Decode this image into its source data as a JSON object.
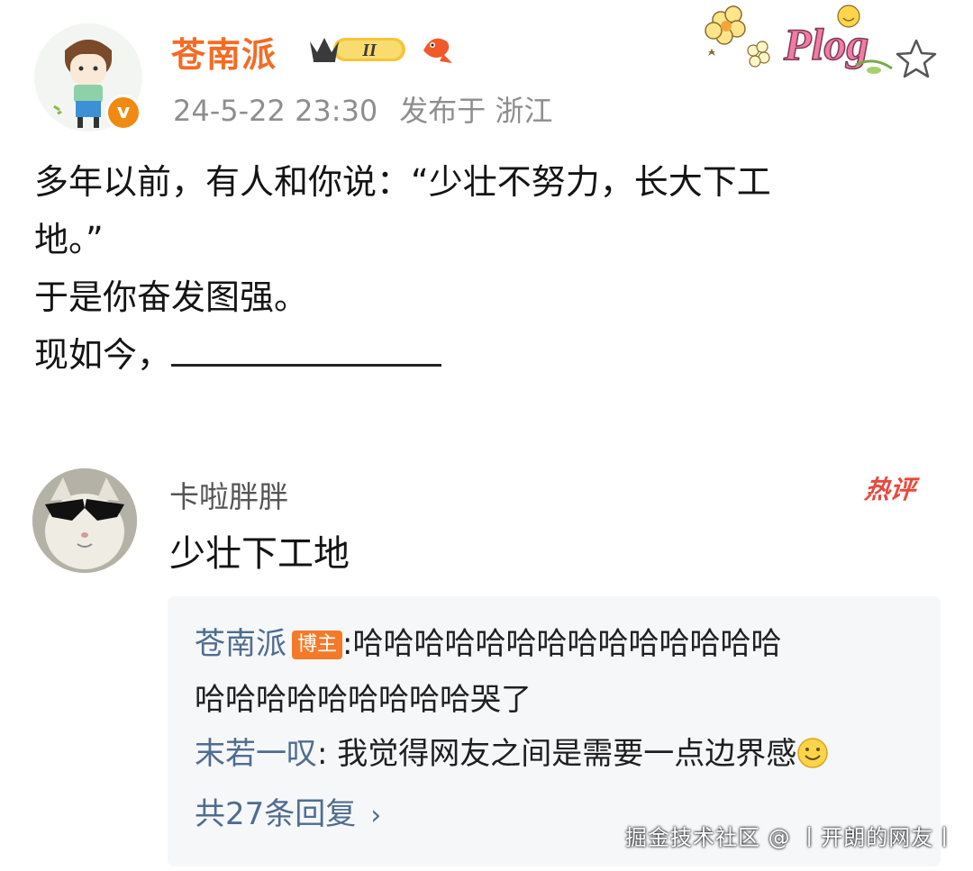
{
  "post": {
    "author": "苍南派",
    "level_badge": "II",
    "timestamp": "24-5-22 23:30",
    "location": "发布于 浙江",
    "decoration_text": "Plog",
    "lines": [
      "多年以前，有人和你说：“少壮不努力，长大下工",
      "地。”",
      "于是你奋发图强。",
      "现如今，"
    ]
  },
  "hot_comment": {
    "user": "卡啦胖胖",
    "badge": "热评",
    "text": "少壮下工地",
    "replies": [
      {
        "author": "苍南派",
        "tag": "博主",
        "separator": ":",
        "text_line1": "哈哈哈哈哈哈哈哈哈哈哈哈哈哈",
        "text_line2": "哈哈哈哈哈哈哈哈哈哭了"
      },
      {
        "author": "末若一叹",
        "separator": ":",
        "text": "我觉得网友之间是需要一点边界感"
      }
    ],
    "more_replies": "共27条回复"
  },
  "watermark": "掘金技术社区 @ 丨开朗的网友丨",
  "colors": {
    "author_orange": "#f26c25",
    "meta_gray": "#8e8e8e",
    "reply_link_blue": "#4e6d8f",
    "hot_red": "#e8493c",
    "reply_bg": "#f6f7f9"
  },
  "icons": [
    "avatar",
    "verified-badge",
    "crown-level-badge",
    "fish-icon",
    "plog-sticker",
    "star-icon",
    "cat-sunglasses-avatar",
    "smile-emoji-icon",
    "chevron-right-icon"
  ]
}
